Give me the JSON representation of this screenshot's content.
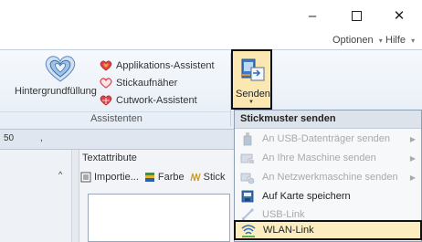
{
  "window": {
    "minimize_glyph": "–",
    "close_glyph": "✕"
  },
  "menubar": {
    "options_label": "Optionen",
    "help_label": "Hilfe",
    "caret": "▾"
  },
  "ribbon": {
    "background_label": "Hintergrundfüllung",
    "group_caption": "Assistenten",
    "small_buttons": [
      {
        "label": "Applikations-Assistent",
        "icon": "heart-icon"
      },
      {
        "label": "Stickaufnäher",
        "icon": "heart-outline-icon"
      },
      {
        "label": "Cutwork-Assistent",
        "icon": "cutwork-heart-icon"
      }
    ],
    "send_label": "Senden",
    "send_arrow": "▼"
  },
  "panel": {
    "ruler_number": "50",
    "ruler_mark": ",",
    "scroll_up_glyph": "^",
    "textattr_title": "Textattribute",
    "toolbar": {
      "import_label": "Importie...",
      "color_label": "Farbe",
      "stitch_label": "Stick"
    }
  },
  "dropdown": {
    "title": "Stickmuster senden",
    "submenu_glyph": "▶",
    "items": [
      {
        "label": "An USB-Datenträger senden",
        "enabled": false,
        "submenu": true,
        "icon": "usb-drive-icon"
      },
      {
        "label": "An Ihre Maschine senden",
        "enabled": false,
        "submenu": true,
        "icon": "machine-icon"
      },
      {
        "label": "An Netzwerkmaschine senden",
        "enabled": false,
        "submenu": true,
        "icon": "network-machine-icon"
      },
      {
        "label": "Auf Karte speichern",
        "enabled": true,
        "submenu": false,
        "icon": "card-save-icon"
      },
      {
        "label": "USB-Link",
        "enabled": false,
        "submenu": false,
        "icon": "usb-link-icon"
      },
      {
        "label": "WLAN-Link",
        "enabled": true,
        "submenu": false,
        "highlighted": true,
        "icon": "wlan-link-icon"
      }
    ]
  },
  "colors": {
    "highlight_bg": "#fcedc0",
    "heart_red": "#e0404a",
    "accent_blue": "#2a6fb8"
  }
}
